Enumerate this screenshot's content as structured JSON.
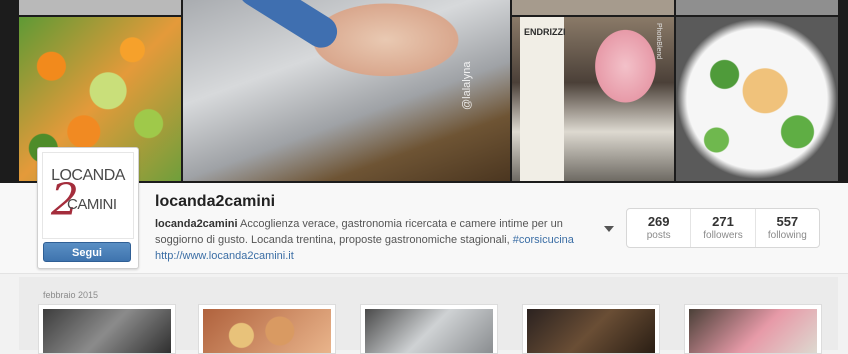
{
  "banner": {
    "photo_watermark": "@lalalyna",
    "wine_label": "ENDRIZZI",
    "wine_side_text": "PhotoBlend"
  },
  "profile": {
    "logo_top": "LOCANDA",
    "logo_number": "2",
    "logo_bottom": "CAMINI",
    "follow_label": "Segui",
    "username": "locanda2camini",
    "bio_name": "locanda2camini",
    "bio_text": " Accoglienza verace, gastronomia ricercata e camere intime per un soggiorno di gusto. Locanda trentina, proposte gastronomiche stagionali, ",
    "bio_hashtag": "#corsicucina",
    "website": "http://www.locanda2camini.it"
  },
  "stats": [
    {
      "value": "269",
      "label": "posts"
    },
    {
      "value": "271",
      "label": "followers"
    },
    {
      "value": "557",
      "label": "following"
    }
  ],
  "feed": {
    "month_label": "febbraio 2015"
  }
}
